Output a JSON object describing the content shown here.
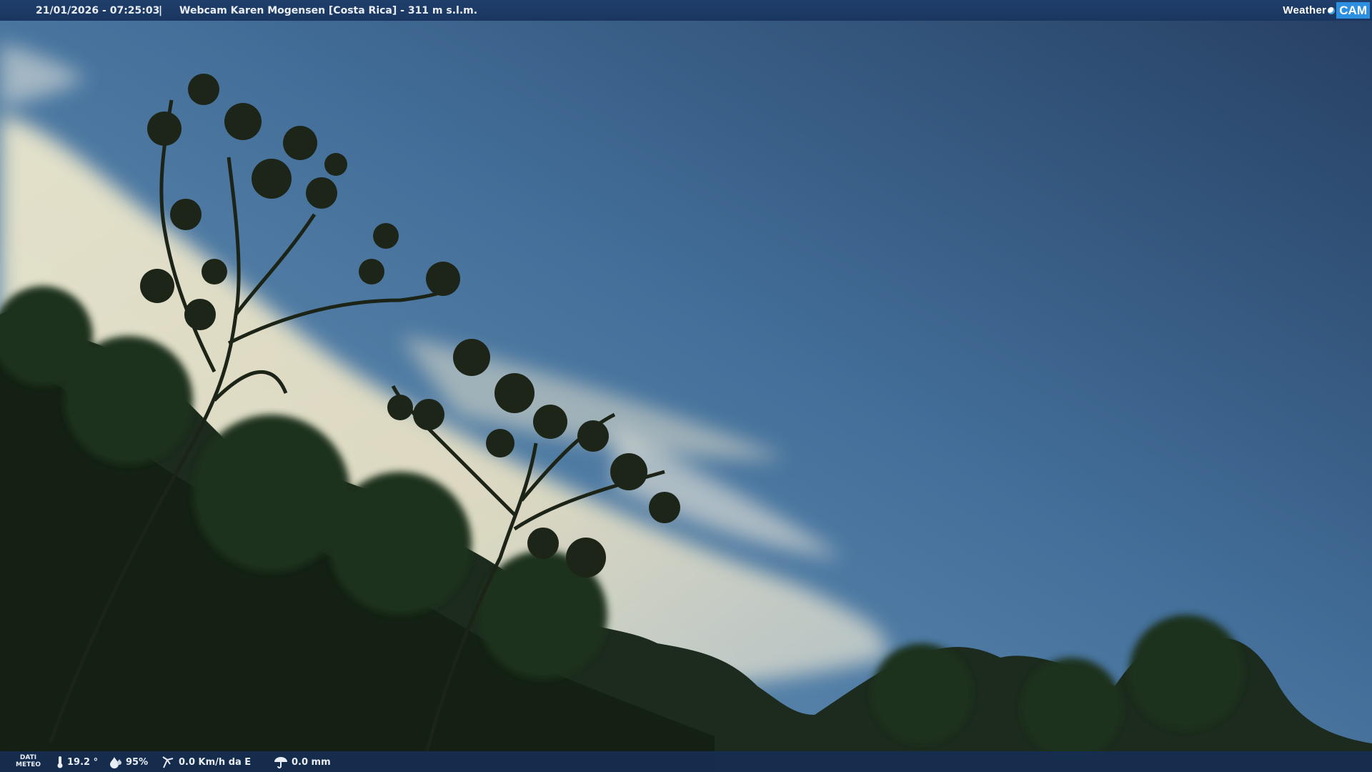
{
  "header": {
    "timestamp": "21/01/2026 - 07:25:03",
    "separator": "|",
    "title": "Webcam Karen Mogensen [Costa Rica]  - 311 m s.l.m.",
    "logo_weather": "Weather",
    "logo_cam": "CAM"
  },
  "footer": {
    "dati_meteo_line1": "DATI",
    "dati_meteo_line2": "METEO",
    "temperature": "19.2 °",
    "humidity": "95%",
    "wind": "0.0 Km/h da E",
    "rain": "0.0 mm"
  },
  "icons": [
    "thermometer-icon",
    "humidity-icon",
    "wind-icon",
    "rain-icon"
  ],
  "colors": {
    "bar": "#1f3f6a",
    "sky_top": "#2d4c75",
    "sky_mid": "#4d7fa8",
    "cloud": "#e8e2c6",
    "foliage": "#1a2a1a"
  }
}
